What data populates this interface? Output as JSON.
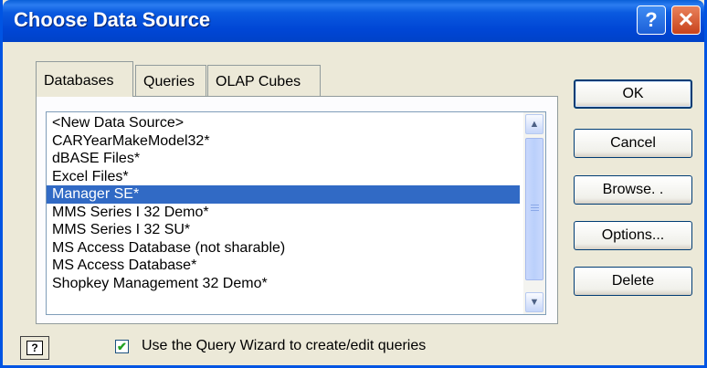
{
  "window": {
    "title": "Choose Data Source",
    "help_button": "?",
    "close_button": "✕"
  },
  "tabs": [
    {
      "label": "Databases",
      "active": true
    },
    {
      "label": "Queries",
      "active": false
    },
    {
      "label": "OLAP Cubes",
      "active": false
    }
  ],
  "list": {
    "items": [
      "<New Data Source>",
      "CARYearMakeModel32*",
      "dBASE Files*",
      "Excel Files*",
      "Manager SE*",
      "MMS Series I  32 Demo*",
      "MMS Series I  32 SU*",
      "MS Access Database (not sharable)",
      "MS Access Database*",
      "Shopkey Management 32 Demo*"
    ],
    "selected_index": 4
  },
  "buttons": {
    "ok": "OK",
    "cancel": "Cancel",
    "browse": "Browse. .",
    "options": "Options...",
    "delete": "Delete"
  },
  "footer": {
    "help_glyph": "?",
    "checkbox_checked": true,
    "checkbox_label": "Use the Query Wizard to create/edit queries"
  },
  "colors": {
    "titlebar": "#0054e3",
    "selection": "#316ac5",
    "dialog_bg": "#ece9d8"
  }
}
